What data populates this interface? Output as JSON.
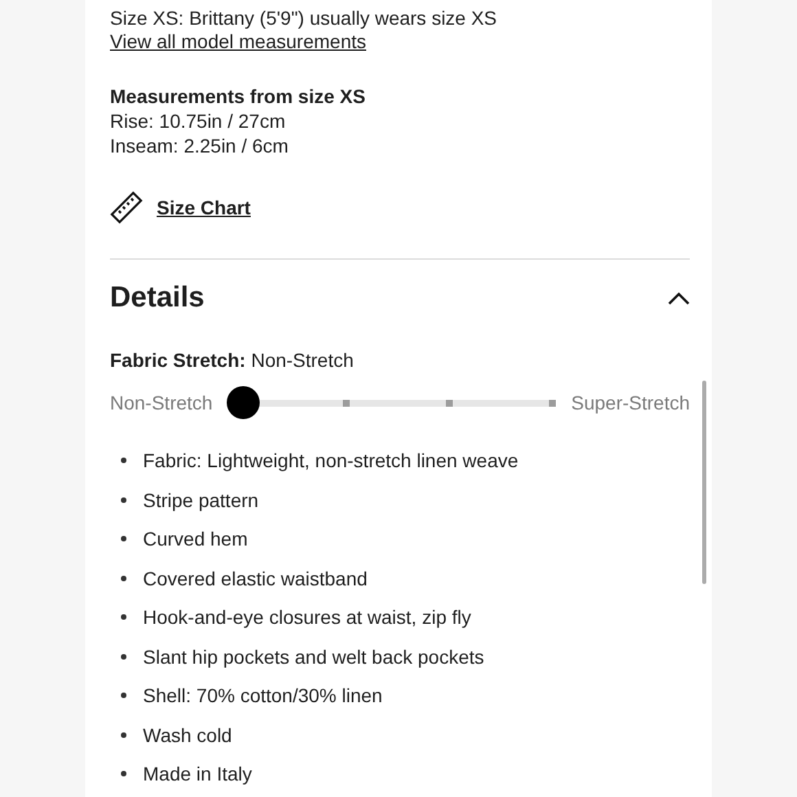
{
  "model_info": {
    "text": "Size XS: Brittany (5'9\") usually wears size XS",
    "link": "View all model measurements"
  },
  "measurements": {
    "title": "Measurements from size XS",
    "lines": [
      "Rise: 10.75in / 27cm",
      "Inseam: 2.25in / 6cm"
    ]
  },
  "size_chart_link": "Size Chart",
  "details": {
    "title": "Details",
    "expanded": true,
    "fabric_stretch": {
      "label": "Fabric Stretch:",
      "value": "Non-Stretch",
      "min_label": "Non-Stretch",
      "max_label": "Super-Stretch",
      "level": 0
    },
    "bullets": [
      "Fabric: Lightweight, non-stretch linen weave",
      "Stripe pattern",
      "Curved hem",
      "Covered elastic waistband",
      "Hook-and-eye closures at waist, zip fly",
      "Slant hip pockets and welt back pockets",
      "Shell: 70% cotton/30% linen",
      "Wash cold",
      "Made in Italy"
    ]
  }
}
